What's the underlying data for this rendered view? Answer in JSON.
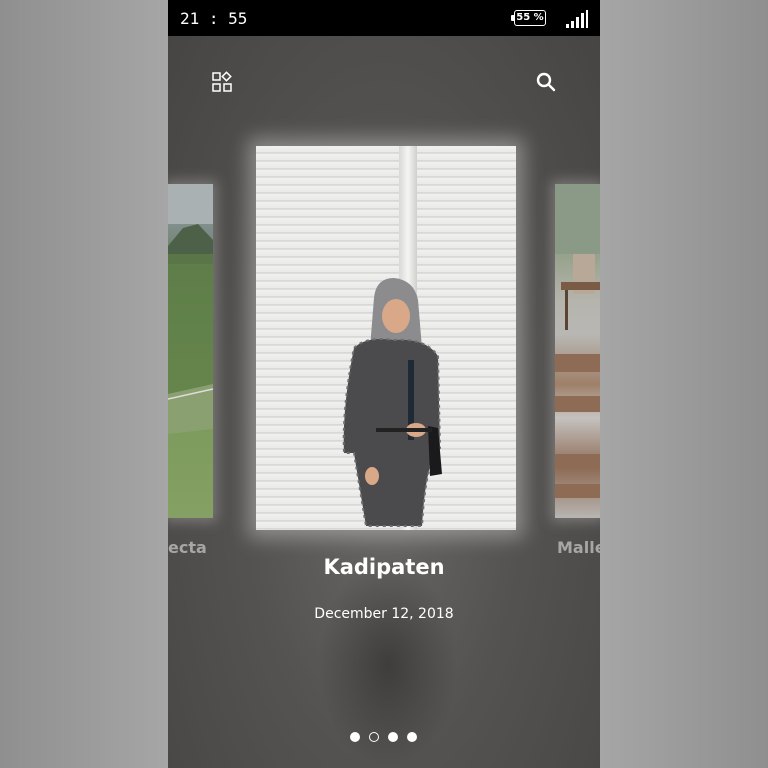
{
  "status_bar": {
    "time": "21 : 55",
    "battery": "55 %"
  },
  "top_bar": {
    "left_icon": "widgets-icon",
    "right_icon": "search-icon"
  },
  "gallery": {
    "cards": [
      {
        "title": "ecta"
      },
      {
        "title": "Kadipaten",
        "date": "December 12, 2018"
      },
      {
        "title": "Malle"
      }
    ],
    "pagination": {
      "count": 4,
      "active_index": 1
    }
  },
  "colors": {
    "status_bar_bg": "#000000",
    "text": "#ffffff",
    "muted_text": "#a8a6a4"
  }
}
